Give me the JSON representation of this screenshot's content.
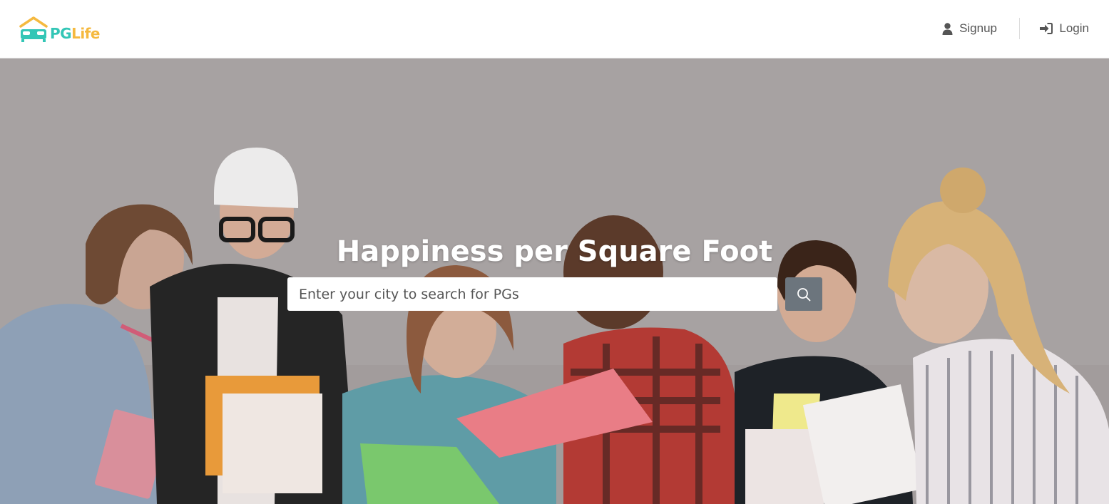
{
  "brand": {
    "pg": "PG",
    "life": "Life"
  },
  "nav": {
    "signup_label": "Signup",
    "login_label": "Login"
  },
  "hero": {
    "title": "Happiness per Square Foot",
    "search_placeholder": "Enter your city to search for PGs",
    "search_value": ""
  },
  "colors": {
    "brand_teal": "#33c6b6",
    "brand_yellow": "#f5b93f",
    "search_button": "#6c757d",
    "nav_text": "#555555"
  },
  "icons": {
    "signup": "user-icon",
    "login": "sign-in-icon",
    "search": "search-icon",
    "logo": "house-bed-icon"
  }
}
